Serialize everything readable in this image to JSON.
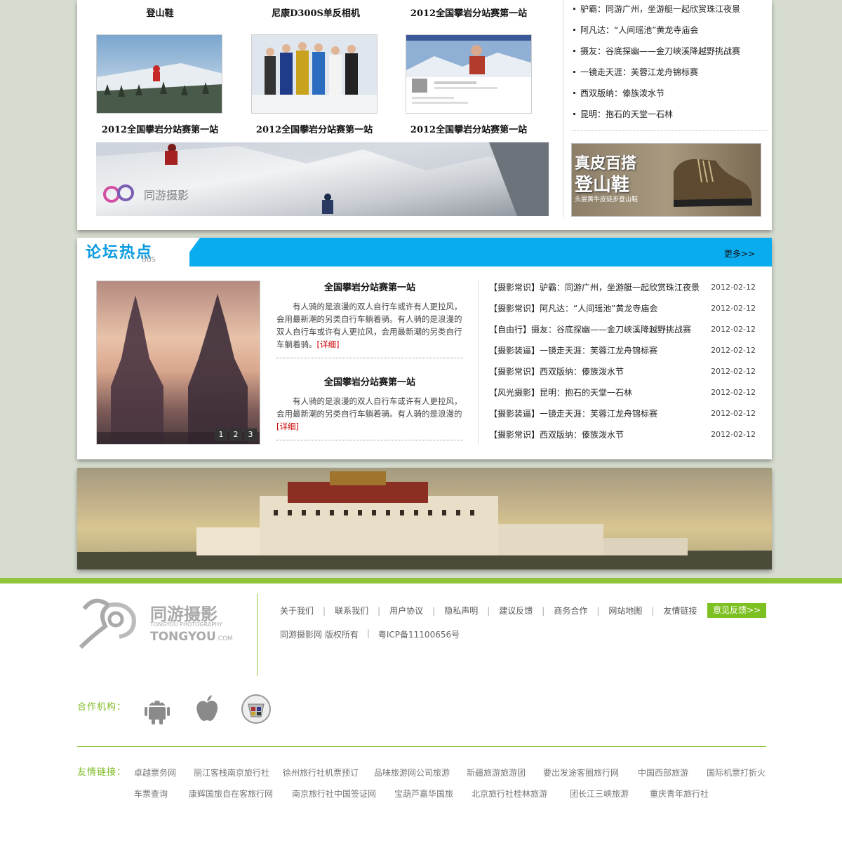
{
  "products": {
    "titles": [
      "登山鞋",
      "尼康D300S单反相机",
      "2012全国攀岩分站赛第一站"
    ],
    "captions": [
      "2012全国攀岩分站赛第一站",
      "2012全国攀岩分站赛第一站",
      "2012全国攀岩分站赛第一站"
    ]
  },
  "banner1": {
    "logo_text": "同游摄影"
  },
  "news": [
    "驴霸：同游广州，坐游艇一起欣赏珠江夜景",
    "阿凡达：“人间瑶池”黄龙寺庙会",
    "摄友：谷底探幽——金刀峡溪降越野挑战赛",
    "一镜走天涯：芙蓉江龙舟锦标赛",
    "西双版纳：傣族泼水节",
    "昆明：抱石的天堂一石林"
  ],
  "ad": {
    "line1": "真皮百搭",
    "line2": "登山鞋",
    "line3": "头层黄牛皮徒步登山鞋"
  },
  "forum": {
    "title": "论坛热点",
    "subtitle": "BBS",
    "more": "更多>>",
    "pager": [
      "1",
      "2",
      "3"
    ],
    "articles": [
      {
        "title": "全国攀岩分站赛第一站",
        "body": "有人骑的是浪漫的双人自行车或许有人更拉风，会用最新潮的另类自行车躺着骑。有人骑的是浪漫的双人自行车或许有人更拉风，会用最新潮的另类自行车躺着骑。",
        "detail": "[详细]"
      },
      {
        "title": "全国攀岩分站赛第一站",
        "body": "有人骑的是浪漫的双人自行车或许有人更拉风，会用最新潮的另类自行车躺着骑。有人骑的是浪漫的",
        "detail": "[详细]"
      }
    ],
    "list": [
      {
        "text": "【摄影常识】驴霸：同游广州，坐游艇一起欣赏珠江夜景",
        "date": "2012-02-12"
      },
      {
        "text": "【摄影常识】阿凡达：“人间瑶池”黄龙寺庙会",
        "date": "2012-02-12"
      },
      {
        "text": "【自由行】摄友：谷底探幽——金刀峡溪降越野挑战赛",
        "date": "2012-02-12"
      },
      {
        "text": "【摄影装逼】一镜走天涯：芙蓉江龙舟锦标赛",
        "date": "2012-02-12"
      },
      {
        "text": "【摄影常识】西双版纳：傣族泼水节",
        "date": "2012-02-12"
      },
      {
        "text": "【风光摄影】昆明：抱石的天堂一石林",
        "date": "2012-02-12"
      },
      {
        "text": "【摄影装逼】一镜走天涯：芙蓉江龙舟锦标赛",
        "date": "2012-02-12"
      },
      {
        "text": "【摄影常识】西双版纳：傣族泼水节",
        "date": "2012-02-12"
      }
    ]
  },
  "footer": {
    "logo_cn": "同游摄影",
    "logo_en1": "TONGYOU PHOTOGRAPHY",
    "logo_en2": "TONGYOU",
    "logo_en3": ".COM",
    "links": [
      "关于我们",
      "联系我们",
      "用户协议",
      "隐私声明",
      "建议反馈",
      "商务合作",
      "网站地图",
      "友情链接"
    ],
    "feedback": "意见反馈>>",
    "copyright": "同游摄影网 版权所有",
    "icp": "粤ICP备11100656号",
    "partner_label": "合作机构：",
    "friend_label": "友情链接：",
    "friends_row1": [
      "卓越票务网",
      "丽江客栈南京旅行社",
      "徐州旅行社机票预订",
      "品味旅游网公司旅游",
      "新疆旅游旅游团",
      "要出发途客圈旅行网",
      "中国西部旅游",
      "国际机票打折火"
    ],
    "friends_row2": [
      "车票查询",
      "康辉国旅自在客旅行网",
      "南京旅行社中国签证网",
      "宝葫芦嘉华国旅",
      "北京旅行社桂林旅游",
      "团长江三峡旅游",
      "重庆青年旅行社"
    ]
  },
  "colors": {
    "accent_blue": "#0aacf0",
    "accent_green": "#8ec53b",
    "detail_red": "#cc0000"
  }
}
